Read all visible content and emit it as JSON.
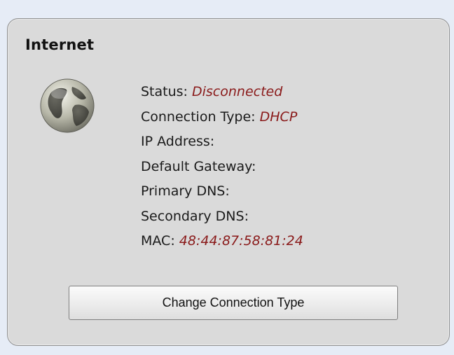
{
  "section": {
    "title": "Internet"
  },
  "status": {
    "label": "Status:",
    "value": "Disconnected"
  },
  "connection_type": {
    "label": "Connection Type:",
    "value": "DHCP"
  },
  "ip_address": {
    "label": "IP Address:"
  },
  "default_gateway": {
    "label": "Default Gateway:"
  },
  "primary_dns": {
    "label": "Primary DNS:"
  },
  "secondary_dns": {
    "label": "Secondary DNS:"
  },
  "mac": {
    "label": "MAC:",
    "value": "48:44:87:58:81:24"
  },
  "actions": {
    "change_connection_type_label": "Change Connection Type"
  },
  "icons": {
    "globe": "globe-icon"
  },
  "colors": {
    "value_text": "#8a1a1a",
    "panel_background": "#dadada",
    "page_background": "#e6ecf6"
  }
}
